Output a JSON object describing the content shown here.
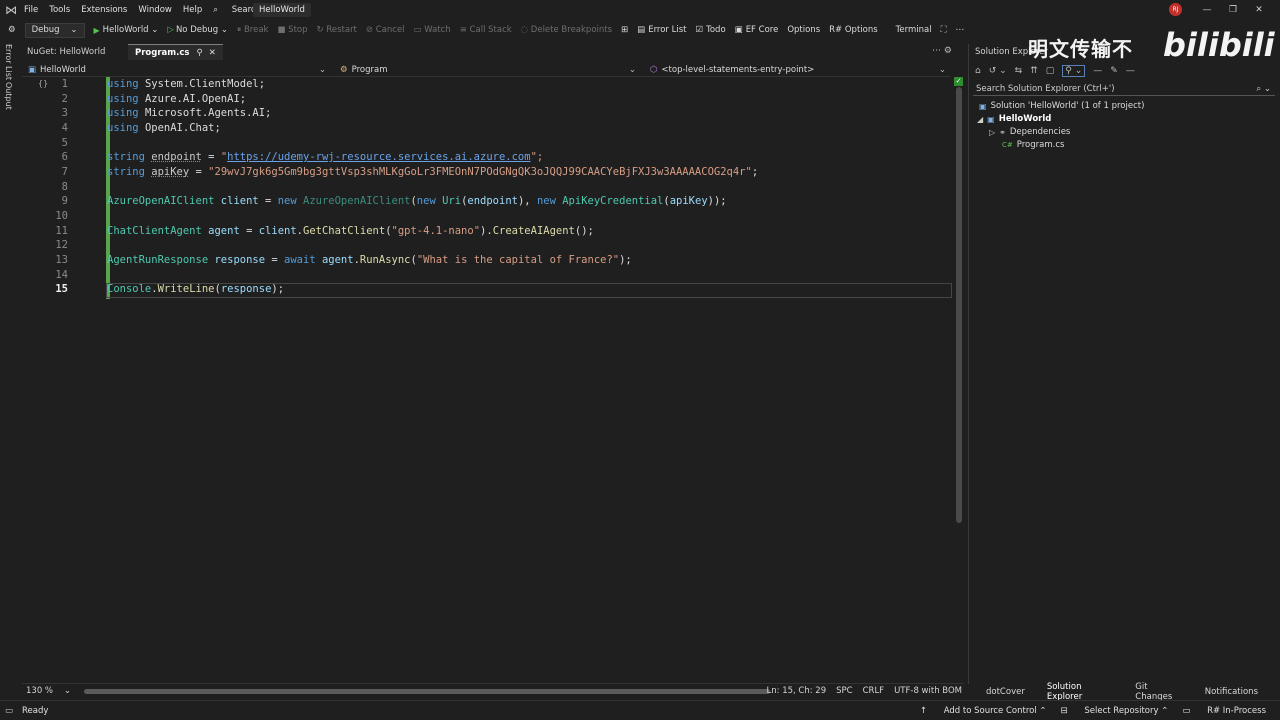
{
  "menu": {
    "items": [
      "File",
      "Tools",
      "Extensions",
      "Window",
      "Help"
    ],
    "search_label": "Search",
    "solution_name": "HelloWorld",
    "avatar_initials": "RJ"
  },
  "toolbar": {
    "config": "Debug",
    "run_target": "HelloWorld",
    "no_debug": "No Debug",
    "break": "Break",
    "stop": "Stop",
    "restart": "Restart",
    "cancel": "Cancel",
    "watch": "Watch",
    "call_stack": "Call Stack",
    "delete_breakpoints": "Delete Breakpoints",
    "error_list": "Error List",
    "todo": "Todo",
    "ef_core": "EF Core",
    "options": "Options",
    "r_options": "R# Options",
    "terminal": "Terminal"
  },
  "left_strip": {
    "error_list": "Error List",
    "output": "Output"
  },
  "tabs": [
    {
      "label": "NuGet: HelloWorld"
    },
    {
      "label": "Program.cs"
    }
  ],
  "navbar": {
    "project": "HelloWorld",
    "type": "Program",
    "member": "<top-level-statements-entry-point>"
  },
  "editor": {
    "line_numbers": [
      "1",
      "2",
      "3",
      "4",
      "5",
      "6",
      "7",
      "8",
      "9",
      "10",
      "11",
      "12",
      "13",
      "14",
      "15"
    ],
    "current_line": "15",
    "code": {
      "l1": {
        "kw": "using",
        "ns": "System.ClientModel;"
      },
      "l2": {
        "kw": "using",
        "ns": "Azure.AI.OpenAI;"
      },
      "l3": {
        "kw": "using",
        "ns": "Microsoft.Agents.AI;"
      },
      "l4": {
        "kw": "using",
        "ns": "OpenAI.Chat;"
      },
      "l6": {
        "type": "string",
        "name": "endpoint",
        "eq": " = ",
        "q1": "\"",
        "url": "https://udemy-rwj-resource.services.ai.azure.com",
        "q2": "\";"
      },
      "l7": {
        "type": "string",
        "name": "apiKey",
        "eq": " = ",
        "value": "\"29wvJ7gk6g5Gm9bg3gttVsp3shMLKgGoLr3FMEOnN7POdGNgQK3oJQQJ99CAACYeBjFXJ3w3AAAAACOG2q4r\"",
        "end": ";"
      },
      "l9": {
        "type": "AzureOpenAIClient",
        "name": "client",
        "eq": " = ",
        "new1": "new",
        "ctor": "AzureOpenAIClient",
        "p1": "(",
        "new2": "new",
        "uri": "Uri",
        "p2": "(",
        "arg1": "endpoint",
        "p3": "), ",
        "new3": "new",
        "cred": "ApiKeyCredential",
        "p4": "(",
        "arg2": "apiKey",
        "p5": "));"
      },
      "l11": {
        "type": "ChatClientAgent",
        "name": "agent",
        "eq": " = ",
        "obj": "client",
        "dot": ".",
        "m1": "GetChatClient",
        "p1": "(",
        "model": "\"gpt-4.1-nano\"",
        "p2": ").",
        "m2": "CreateAIAgent",
        "p3": "();"
      },
      "l13": {
        "type": "AgentRunResponse",
        "name": "response",
        "eq": " = ",
        "await": "await",
        "obj": "agent",
        "dot": ".",
        "m": "RunAsync",
        "p1": "(",
        "prompt": "\"What is the capital of France?\"",
        "p2": ");"
      },
      "l15": {
        "cls": "Console",
        "dot": ".",
        "m": "WriteLine",
        "p1": "(",
        "arg": "response",
        "p2": ");"
      }
    },
    "fold_marker": "{}"
  },
  "editor_status": {
    "zoom": "130 %",
    "position": "Ln: 15, Ch: 29",
    "spc": "SPC",
    "crlf": "CRLF",
    "encoding": "UTF-8 with BOM"
  },
  "solution_explorer": {
    "title": "Solution Explorer",
    "search_placeholder": "Search Solution Explorer (Ctrl+')",
    "solution": "Solution 'HelloWorld' (1 of 1 project)",
    "project": "HelloWorld",
    "dependencies": "Dependencies",
    "file": "Program.cs",
    "file_icon_text": "C#"
  },
  "watermark": {
    "text1": "明文传输不",
    "text2": "bilibili"
  },
  "bottom_tabs": [
    "dotCover",
    "Solution Explorer",
    "Git Changes",
    "Notifications"
  ],
  "status": {
    "ready": "Ready",
    "add_to_source": "Add to Source Control",
    "select_repo": "Select Repository",
    "rsharp": "R# In-Process"
  },
  "colors": {
    "background": "#1f1f1f",
    "keyword": "#569cd6",
    "type": "#4ec9b0",
    "string": "#d69d85",
    "method": "#dcdcaa",
    "change_bar": "#57a64a"
  }
}
